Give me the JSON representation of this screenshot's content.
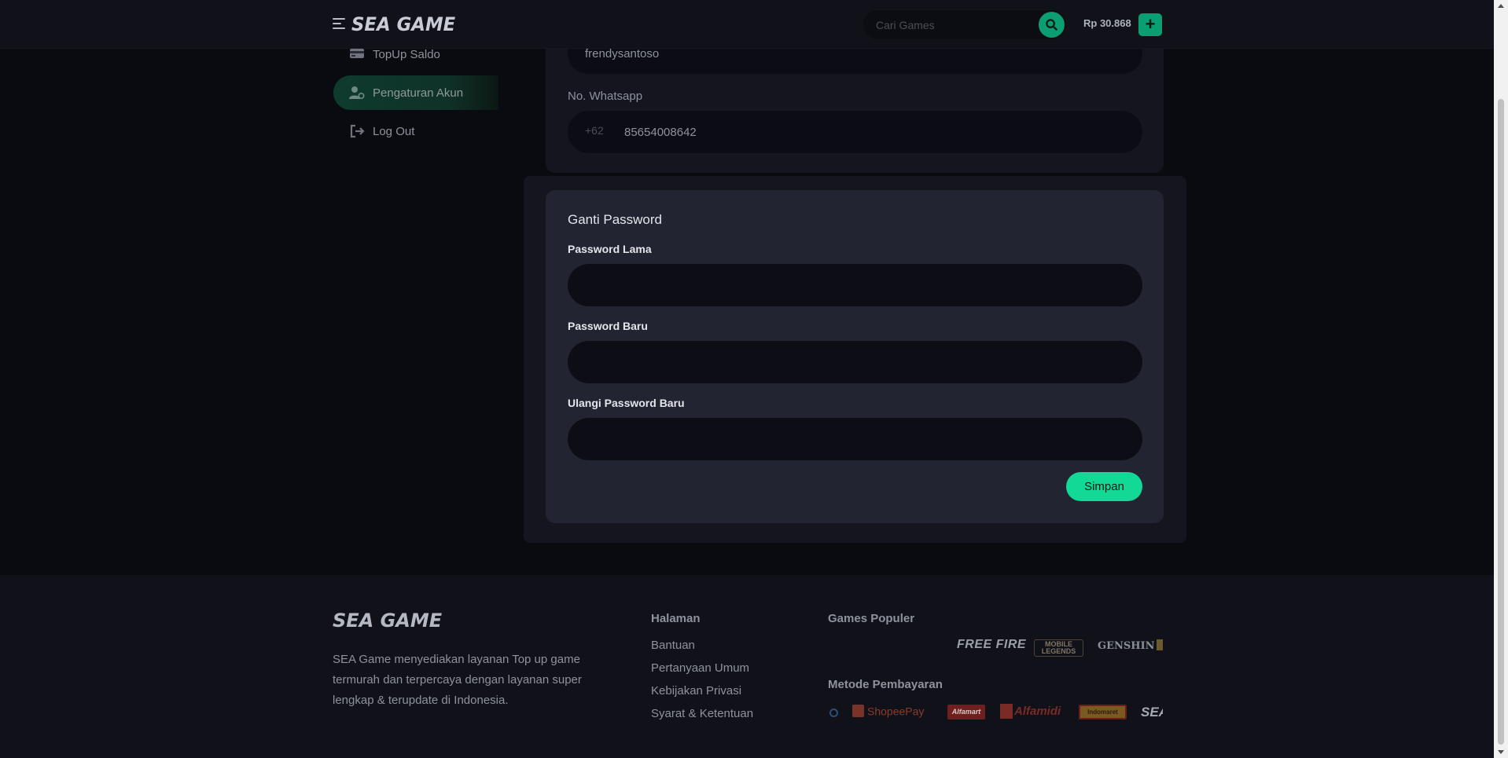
{
  "header": {
    "logo": "SEA GAME",
    "search_placeholder": "Cari Games",
    "balance": "Rp 30.868",
    "add_label": "+"
  },
  "sidebar": {
    "items": [
      {
        "label": "TopUp Saldo",
        "icon": "wallet-icon"
      },
      {
        "label": "Pengaturan Akun",
        "icon": "user-gear-icon",
        "active": true
      },
      {
        "label": "Log Out",
        "icon": "logout-icon"
      }
    ]
  },
  "account": {
    "username_value": "frendysantoso",
    "whatsapp_label": "No. Whatsapp",
    "whatsapp_prefix": "+62",
    "whatsapp_value": "85654008642"
  },
  "password_form": {
    "title": "Ganti Password",
    "old_label": "Password Lama",
    "new_label": "Password Baru",
    "confirm_label": "Ulangi Password Baru",
    "save_label": "Simpan"
  },
  "footer": {
    "logo": "SEA GAME",
    "description": "SEA Game menyediakan layanan Top up game termurah dan terpercaya dengan layanan super lengkap & terupdate di Indonesia.",
    "pages_heading": "Halaman",
    "pages": [
      "Bantuan",
      "Pertanyaan Umum",
      "Kebijakan Privasi",
      "Syarat & Ketentuan"
    ],
    "games_heading": "Games Populer",
    "games": [
      "FREE FIRE",
      "MOBILE LEGENDS",
      "GENSHIN"
    ],
    "payments_heading": "Metode Pembayaran",
    "payments": [
      "ShopeePay",
      "Alfamart",
      "Alfamidi",
      "Indomaret",
      "SEA"
    ]
  },
  "colors": {
    "accent": "#12d996",
    "accent_dark": "#0a9e72",
    "background": "#0a0b11",
    "card": "#222431"
  }
}
